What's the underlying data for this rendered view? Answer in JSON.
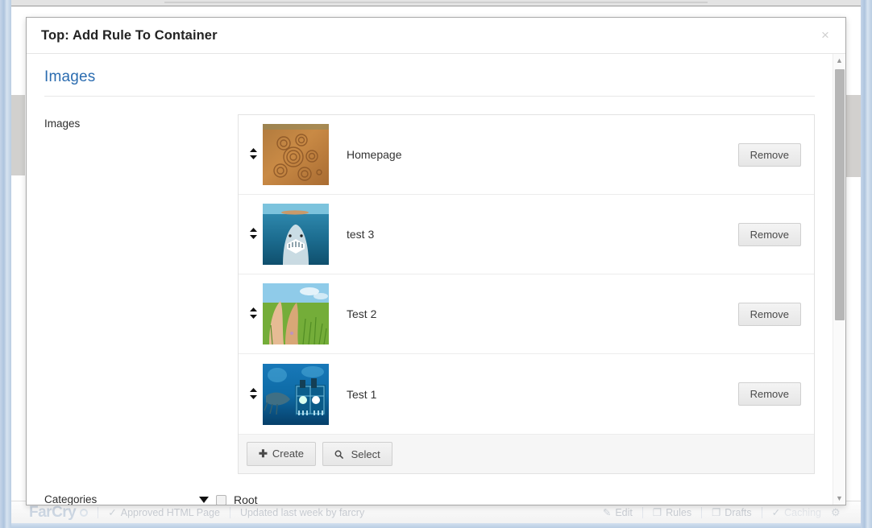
{
  "window": {
    "modal": {
      "title": "Top: Add Rule To Container",
      "close_label": "×"
    }
  },
  "form": {
    "section_heading": "Images",
    "images_field": {
      "label": "Images",
      "rows": [
        {
          "label": "Homepage",
          "thumb": "ochre-spiral-rock-art-thumbnail",
          "remove_label": "Remove",
          "handle_icon": "drag-updown-icon"
        },
        {
          "label": "test 3",
          "thumb": "shark-underwater-jaws-thumbnail",
          "remove_label": "Remove",
          "handle_icon": "drag-updown-icon"
        },
        {
          "label": "Test 2",
          "thumb": "legs-walking-in-grass-thumbnail",
          "remove_label": "Remove",
          "handle_icon": "drag-updown-icon"
        },
        {
          "label": "Test 1",
          "thumb": "submarine-squid-deep-sea-thumbnail",
          "remove_label": "Remove",
          "handle_icon": "drag-updown-icon"
        }
      ],
      "footer_buttons": [
        {
          "icon": "plus-icon",
          "glyph": "✚",
          "label": "Create"
        },
        {
          "icon": "search-icon",
          "glyph": "⌕",
          "label": "Select"
        }
      ]
    },
    "categories_field": {
      "label": "Categories",
      "root_label": "Root",
      "expand_icon": "triangle-down-icon",
      "checkbox_checked": false
    }
  },
  "scrollbar": {
    "up_glyph": "▲",
    "down_glyph": "▼"
  },
  "statusbar": {
    "logo": "FarCry",
    "status": "Approved HTML Page",
    "status_icon": "check-icon",
    "status_glyph": "✓",
    "updated": "Updated last week by farcry",
    "actions": [
      {
        "name": "edit",
        "glyph": "✎",
        "label": "Edit",
        "faint": false
      },
      {
        "name": "rules",
        "glyph": "❐",
        "label": "Rules",
        "faint": false
      },
      {
        "name": "drafts",
        "glyph": "❐",
        "label": "Drafts",
        "faint": false
      },
      {
        "name": "caching",
        "glyph": "✓",
        "label": "Caching",
        "faint": true
      }
    ],
    "gear_glyph": "⚙"
  },
  "colors": {
    "heading_blue": "#2b6cb0",
    "frame_blue": "#b9cde3",
    "text_dark": "#2d2d2d",
    "statusbar_text": "#c8ccd2"
  }
}
